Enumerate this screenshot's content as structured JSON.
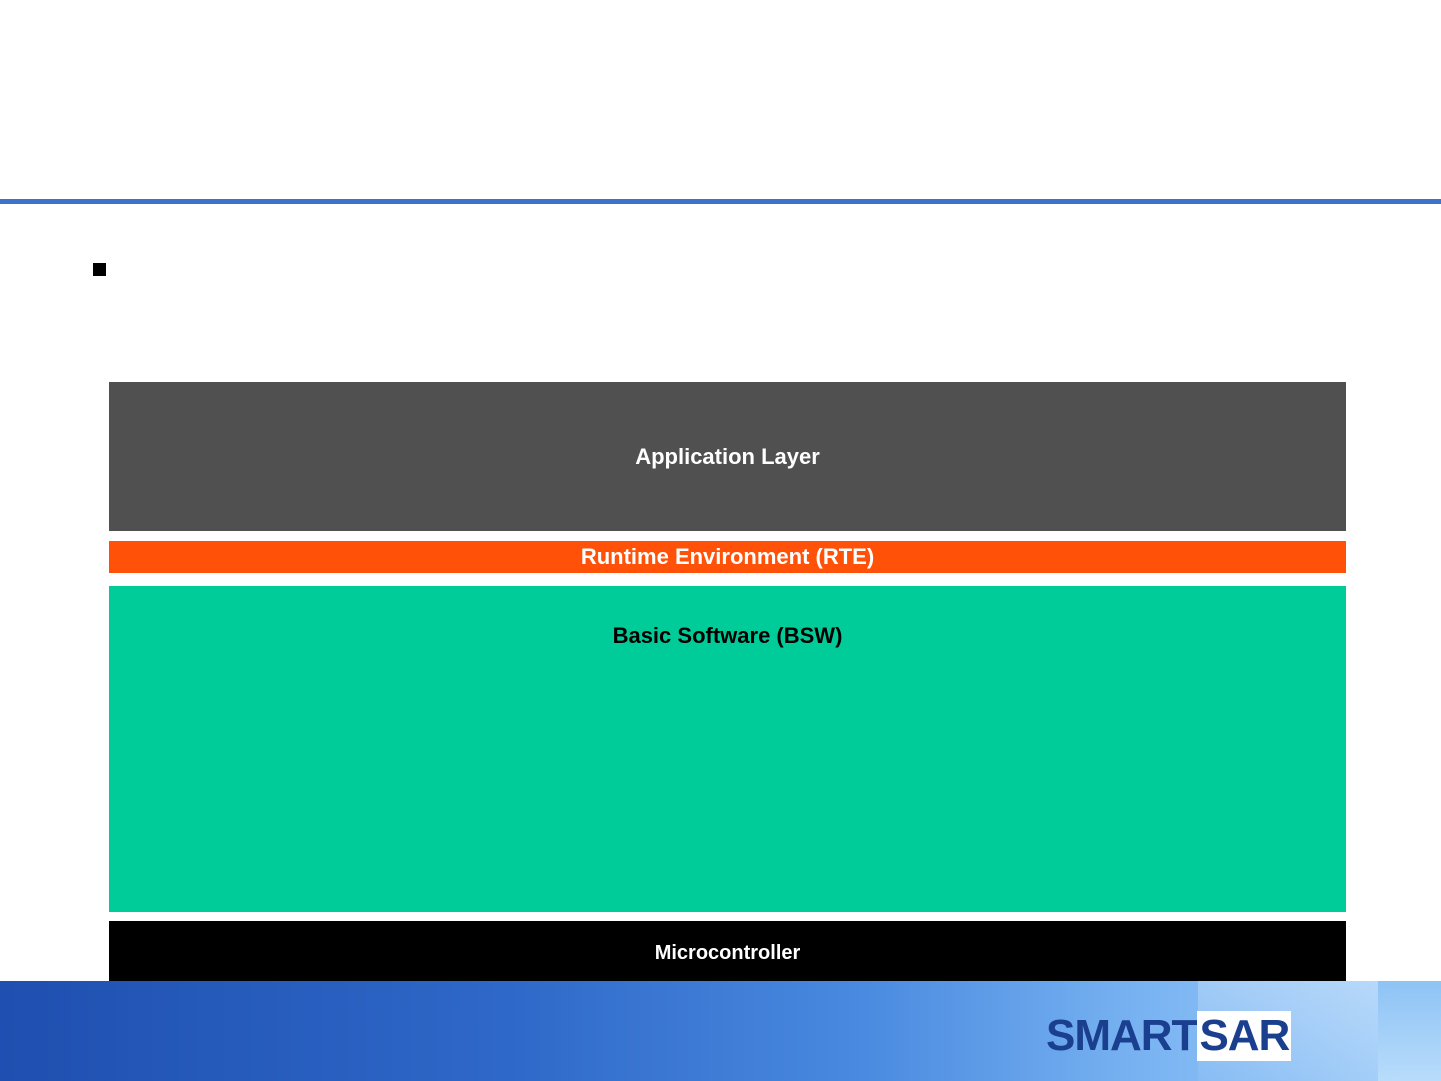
{
  "diagram": {
    "layers": {
      "application": "Application Layer",
      "rte": "Runtime Environment (RTE)",
      "bsw": "Basic Software (BSW)",
      "microcontroller": "Microcontroller"
    }
  },
  "footer": {
    "logo_part_a": "SMART",
    "logo_part_b": "SAR"
  },
  "colors": {
    "title_rule": "#3d72c9",
    "application": "#505050",
    "rte": "#ff5107",
    "bsw": "#00cc99",
    "microcontroller": "#000000"
  }
}
